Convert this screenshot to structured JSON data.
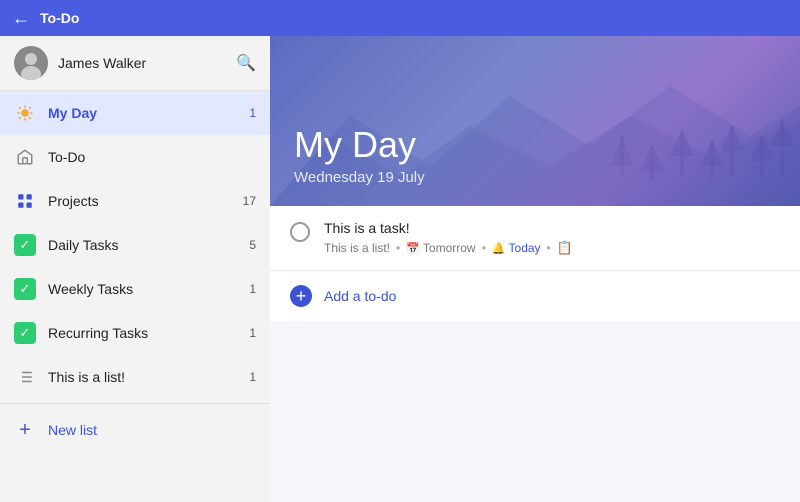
{
  "topbar": {
    "title": "To-Do",
    "back_icon": "←"
  },
  "sidebar": {
    "user": {
      "name": "James Walker"
    },
    "items": [
      {
        "id": "my-day",
        "label": "My Day",
        "badge": "1",
        "icon": "sun",
        "active": true
      },
      {
        "id": "todo",
        "label": "To-Do",
        "badge": "",
        "icon": "house",
        "active": false
      },
      {
        "id": "projects",
        "label": "Projects",
        "badge": "17",
        "icon": "grid",
        "active": false
      },
      {
        "id": "daily-tasks",
        "label": "Daily Tasks",
        "badge": "5",
        "icon": "check-green",
        "active": false
      },
      {
        "id": "weekly-tasks",
        "label": "Weekly Tasks",
        "badge": "1",
        "icon": "check-green",
        "active": false
      },
      {
        "id": "recurring-tasks",
        "label": "Recurring Tasks",
        "badge": "1",
        "icon": "check-green",
        "active": false
      },
      {
        "id": "this-is-a-list",
        "label": "This is a list!",
        "badge": "1",
        "icon": "list",
        "active": false
      }
    ],
    "new_list_label": "New list"
  },
  "main": {
    "title": "My Day",
    "date": "Wednesday 19 July",
    "tasks": [
      {
        "title": "This is a task!",
        "list": "This is a list!",
        "due": "Tomorrow",
        "reminder": "Today",
        "has_note": true
      }
    ],
    "add_todo_label": "Add a to-do"
  }
}
